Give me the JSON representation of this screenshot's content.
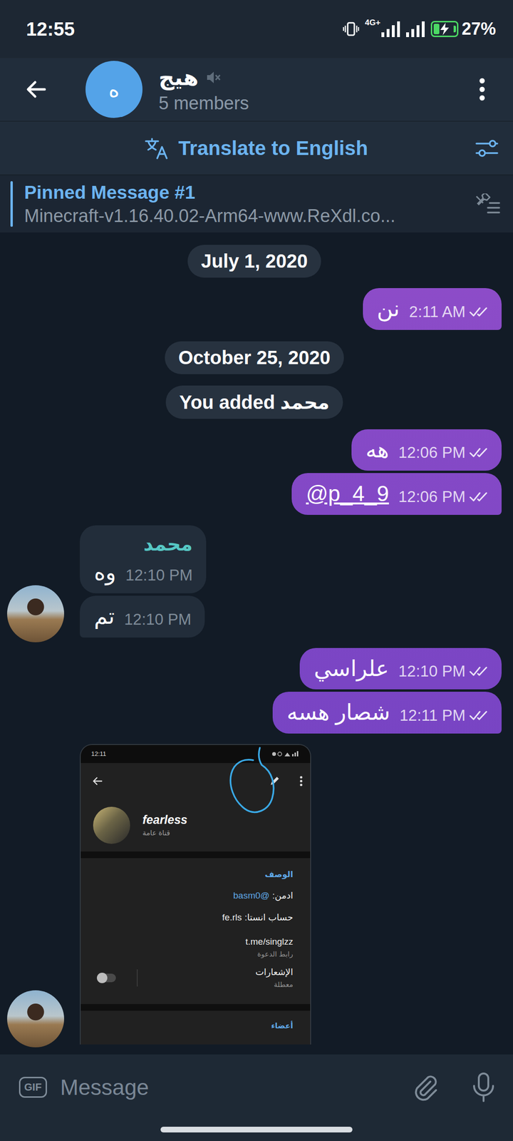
{
  "status_bar": {
    "time": "12:55",
    "network": "4G+",
    "battery": {
      "text": "27%",
      "level": 0.27,
      "charging": true
    }
  },
  "header": {
    "avatar_letter": "ه",
    "title": "هيج",
    "muted": true,
    "subtitle": "5 members"
  },
  "translate_bar": {
    "label": "Translate to English"
  },
  "pinned": {
    "title": "Pinned Message #1",
    "text": "Minecraft-v1.16.40.02-Arm64-www.ReXdl.co..."
  },
  "messages": [
    {
      "kind": "date",
      "text": "July 1, 2020"
    },
    {
      "kind": "text",
      "out": true,
      "text": "نن",
      "time": "2:11 AM",
      "read": true,
      "link": false
    },
    {
      "kind": "date",
      "text": "October 25, 2020"
    },
    {
      "kind": "service",
      "text": "You added محمد"
    },
    {
      "kind": "text",
      "out": true,
      "text": "هه",
      "time": "12:06 PM",
      "read": true,
      "link": false
    },
    {
      "kind": "text",
      "out": true,
      "text": "@p_4_9",
      "time": "12:06 PM",
      "read": true,
      "link": true
    },
    {
      "kind": "text",
      "out": false,
      "sender": "محمد",
      "text": "وه",
      "time": "12:10 PM",
      "link": false,
      "avatar": false
    },
    {
      "kind": "text",
      "out": false,
      "text": "تم",
      "time": "12:10 PM",
      "link": false,
      "avatar": true
    },
    {
      "kind": "text",
      "out": true,
      "text": "علراسي",
      "time": "12:10 PM",
      "read": true,
      "link": false
    },
    {
      "kind": "text",
      "out": true,
      "text": "شصار هسه",
      "time": "12:11 PM",
      "read": true,
      "link": false
    },
    {
      "kind": "image",
      "out": false,
      "avatar": true,
      "screenshot": {
        "time": "12:11",
        "title": "fearless",
        "subtitle": "قناة عامة",
        "edit_circled": true,
        "section": "الوصف",
        "rows": [
          {
            "kind": "pair",
            "label": "ادمن:",
            "value": "@basm0",
            "link": true
          },
          {
            "kind": "pair",
            "label": "حساب انستا:",
            "value": "fe.rls",
            "link": false
          },
          {
            "kind": "caption",
            "value": "t.me/singlzz",
            "caption": "رابط الدعوة"
          }
        ],
        "notifications": {
          "label": "الإشعارات",
          "caption": "معطلة",
          "on": false
        },
        "members_label": "أعضاء"
      }
    }
  ],
  "composer": {
    "gif_label": "GIF",
    "placeholder": "Message"
  }
}
